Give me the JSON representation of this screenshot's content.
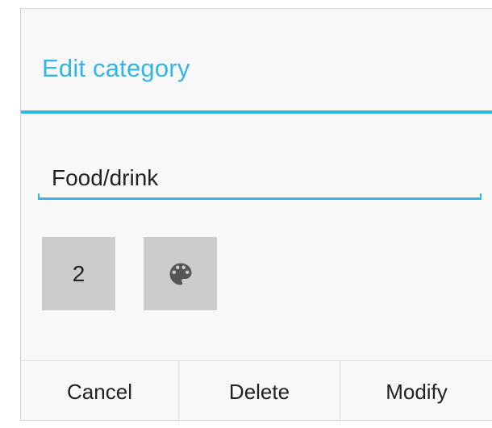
{
  "dialog": {
    "title": "Edit category",
    "name_value": "Food/drink",
    "number_button_label": "2",
    "palette_icon": "palette-icon",
    "actions": {
      "cancel": "Cancel",
      "delete": "Delete",
      "modify": "Modify"
    }
  },
  "colors": {
    "accent": "#33b5e5",
    "button_bg": "#cccccc",
    "icon": "#555555"
  }
}
